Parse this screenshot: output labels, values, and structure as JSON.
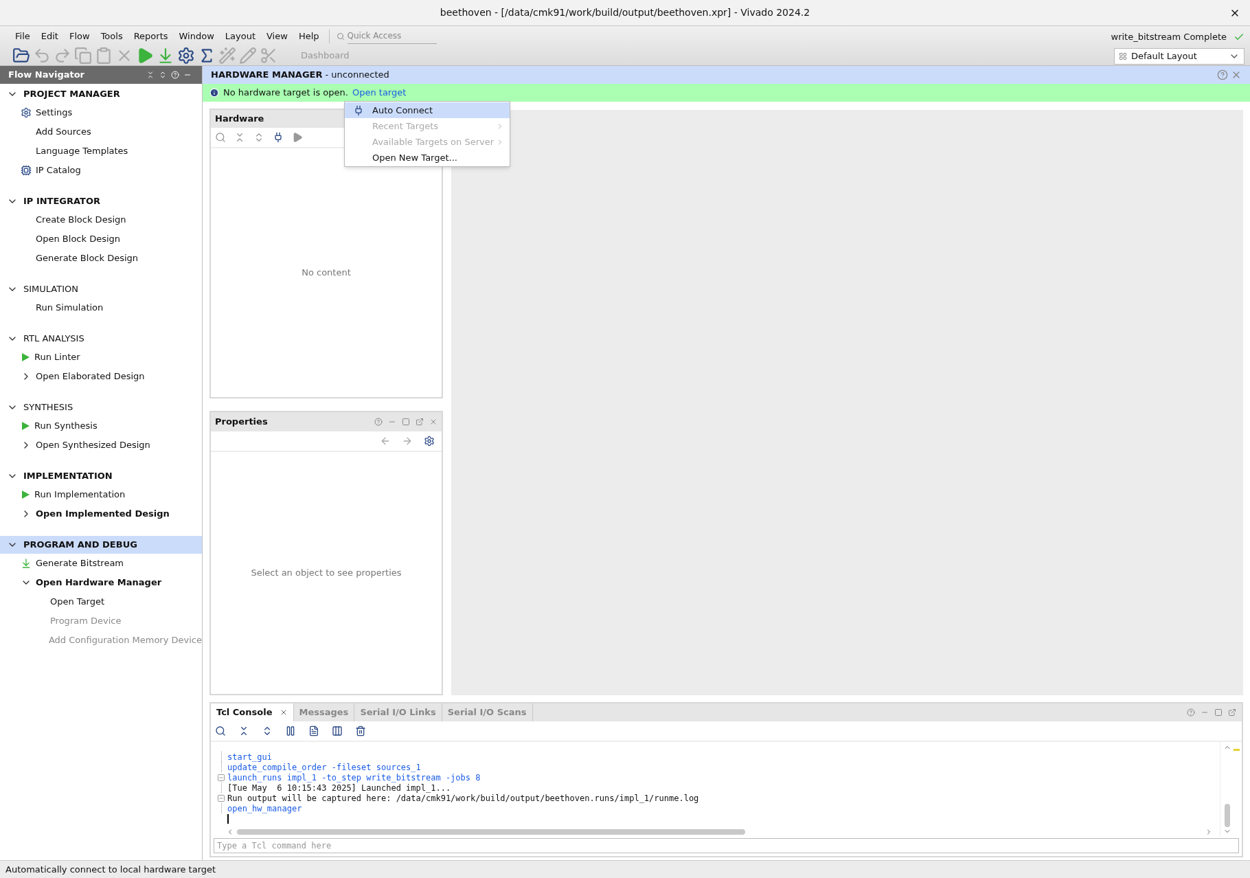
{
  "window": {
    "title": "beethoven - [/data/cmk91/work/build/output/beethoven.xpr] - Vivado 2024.2"
  },
  "menu_bar": [
    "File",
    "Edit",
    "Flow",
    "Tools",
    "Reports",
    "Window",
    "Layout",
    "View",
    "Help"
  ],
  "quick_access": {
    "placeholder": "Quick Access"
  },
  "toolbar": {
    "dashboard": "Dashboard"
  },
  "run_status": "write_bitstream Complete",
  "layout_select": {
    "value": "Default Layout"
  },
  "flow_navigator": {
    "title": "Flow Navigator",
    "sections": [
      {
        "label": "PROJECT MANAGER",
        "bold": true,
        "selected": false,
        "items": [
          {
            "label": "Settings",
            "kind": "settings",
            "bold": false,
            "disabled": false
          },
          {
            "label": "Add Sources",
            "bold": false,
            "disabled": false
          },
          {
            "label": "Language Templates",
            "bold": false,
            "disabled": false
          },
          {
            "label": "IP Catalog",
            "kind": "catalog",
            "bold": false,
            "disabled": false
          }
        ]
      },
      {
        "label": "IP INTEGRATOR",
        "bold": true,
        "selected": false,
        "items": [
          {
            "label": "Create Block Design",
            "bold": false,
            "disabled": false
          },
          {
            "label": "Open Block Design",
            "bold": false,
            "disabled": false
          },
          {
            "label": "Generate Block Design",
            "bold": false,
            "disabled": false
          }
        ]
      },
      {
        "label": "SIMULATION",
        "bold": false,
        "selected": false,
        "items": [
          {
            "label": "Run Simulation",
            "bold": false,
            "disabled": false
          }
        ]
      },
      {
        "label": "RTL ANALYSIS",
        "bold": false,
        "selected": false,
        "items": [
          {
            "label": "Run Linter",
            "kind": "run",
            "bold": false,
            "disabled": false
          },
          {
            "label": "Open Elaborated Design",
            "expanded": false,
            "bold": false,
            "disabled": false
          }
        ]
      },
      {
        "label": "SYNTHESIS",
        "bold": false,
        "selected": false,
        "items": [
          {
            "label": "Run Synthesis",
            "kind": "run",
            "bold": false,
            "disabled": false
          },
          {
            "label": "Open Synthesized Design",
            "expanded": false,
            "bold": false,
            "disabled": false
          }
        ]
      },
      {
        "label": "IMPLEMENTATION",
        "bold": true,
        "selected": false,
        "items": [
          {
            "label": "Run Implementation",
            "kind": "run",
            "bold": false,
            "disabled": false
          },
          {
            "label": "Open Implemented Design",
            "expanded": false,
            "bold": true,
            "disabled": false
          }
        ]
      },
      {
        "label": "PROGRAM AND DEBUG",
        "bold": true,
        "selected": true,
        "items": [
          {
            "label": "Generate Bitstream",
            "kind": "generate",
            "bold": false,
            "disabled": false
          },
          {
            "label": "Open Hardware Manager",
            "expanded": true,
            "bold": true,
            "disabled": false,
            "children": [
              {
                "label": "Open Target",
                "bold": false,
                "disabled": false
              },
              {
                "label": "Program Device",
                "bold": false,
                "disabled": true
              },
              {
                "label": "Add Configuration Memory Device",
                "bold": false,
                "disabled": true
              }
            ]
          }
        ]
      }
    ]
  },
  "hardware_manager": {
    "title": "HARDWARE MANAGER",
    "subtitle": "- unconnected",
    "banner": {
      "text": "No hardware target is open.",
      "link": "Open target"
    }
  },
  "hardware_panel": {
    "title": "Hardware",
    "empty_text": "No content"
  },
  "context_menu": {
    "items": [
      {
        "label": "Auto Connect",
        "selected": true,
        "disabled": false,
        "submenu": false
      },
      {
        "label": "Recent Targets",
        "selected": false,
        "disabled": true,
        "submenu": true
      },
      {
        "label": "Available Targets on Server",
        "selected": false,
        "disabled": true,
        "submenu": true
      },
      {
        "label": "Open New Target...",
        "selected": false,
        "disabled": false,
        "submenu": false
      }
    ]
  },
  "properties_panel": {
    "title": "Properties",
    "empty_text": "Select an object to see properties"
  },
  "console": {
    "tabs": [
      {
        "label": "Tcl Console",
        "selected": true
      },
      {
        "label": "Messages",
        "selected": false
      },
      {
        "label": "Serial I/O Links",
        "selected": false
      },
      {
        "label": "Serial I/O Scans",
        "selected": false
      }
    ],
    "lines": [
      {
        "text": "start_gui",
        "kind": "command",
        "fold": false
      },
      {
        "text": "update_compile_order -fileset sources_1",
        "kind": "command",
        "fold": false
      },
      {
        "text": "launch_runs impl_1 -to_step write_bitstream -jobs 8",
        "kind": "command",
        "fold": true
      },
      {
        "text": "[Tue May  6 10:15:43 2025] Launched impl_1...",
        "kind": "output",
        "fold": false
      },
      {
        "text": "Run output will be captured here: /data/cmk91/work/build/output/beethoven.runs/impl_1/runme.log",
        "kind": "output",
        "fold": true
      },
      {
        "text": "open_hw_manager",
        "kind": "command",
        "fold": false
      }
    ],
    "input": {
      "placeholder": "Type a Tcl command here"
    }
  },
  "status_bar": "Automatically connect to local hardware target"
}
